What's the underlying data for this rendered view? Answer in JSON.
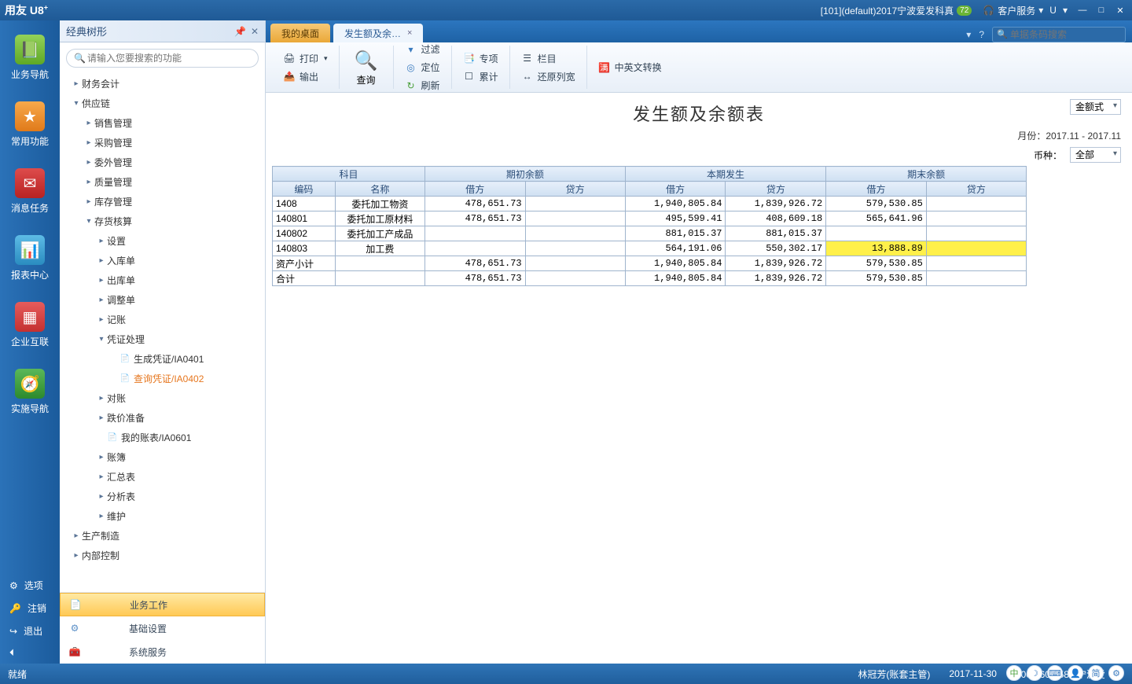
{
  "titlebar": {
    "logo": "用友 U8",
    "logo_sup": "+",
    "doc_title": "[101](default)2017宁波爱发科真",
    "badge": "72",
    "svc": "客户服务",
    "u": "U"
  },
  "leftnav": {
    "items": [
      {
        "label": "业务导航"
      },
      {
        "label": "常用功能"
      },
      {
        "label": "消息任务"
      },
      {
        "label": "报表中心"
      },
      {
        "label": "企业互联"
      },
      {
        "label": "实施导航"
      }
    ],
    "bottom": [
      {
        "icon": "⚙",
        "label": "选项"
      },
      {
        "icon": "🔑",
        "label": "注销"
      },
      {
        "icon": "↪",
        "label": "退出"
      }
    ]
  },
  "sidepanel": {
    "title": "经典树形",
    "search_placeholder": "请输入您要搜索的功能",
    "bottom_tabs": [
      {
        "label": "业务工作",
        "active": true
      },
      {
        "label": "基础设置",
        "active": false
      },
      {
        "label": "系统服务",
        "active": false
      }
    ]
  },
  "tree": [
    {
      "lvl": 1,
      "arrow": "▸",
      "label": "财务会计"
    },
    {
      "lvl": 1,
      "arrow": "▾",
      "label": "供应链"
    },
    {
      "lvl": 2,
      "arrow": "▸",
      "label": "销售管理"
    },
    {
      "lvl": 2,
      "arrow": "▸",
      "label": "采购管理"
    },
    {
      "lvl": 2,
      "arrow": "▸",
      "label": "委外管理"
    },
    {
      "lvl": 2,
      "arrow": "▸",
      "label": "质量管理"
    },
    {
      "lvl": 2,
      "arrow": "▸",
      "label": "库存管理"
    },
    {
      "lvl": 2,
      "arrow": "▾",
      "label": "存货核算"
    },
    {
      "lvl": 3,
      "arrow": "▸",
      "label": "设置"
    },
    {
      "lvl": 3,
      "arrow": "▸",
      "label": "入库单"
    },
    {
      "lvl": 3,
      "arrow": "▸",
      "label": "出库单"
    },
    {
      "lvl": 3,
      "arrow": "▸",
      "label": "调整单"
    },
    {
      "lvl": 3,
      "arrow": "▸",
      "label": "记账"
    },
    {
      "lvl": 3,
      "arrow": "▾",
      "label": "凭证处理"
    },
    {
      "lvl": 4,
      "doc": true,
      "label": "生成凭证/IA0401"
    },
    {
      "lvl": 4,
      "doc": true,
      "label": "查询凭证/IA0402",
      "sel": true
    },
    {
      "lvl": 3,
      "arrow": "▸",
      "label": "对账"
    },
    {
      "lvl": 3,
      "arrow": "▸",
      "label": "跌价准备"
    },
    {
      "lvl": 3,
      "doc": true,
      "label": "我的账表/IA0601"
    },
    {
      "lvl": 3,
      "arrow": "▸",
      "label": "账簿"
    },
    {
      "lvl": 3,
      "arrow": "▸",
      "label": "汇总表"
    },
    {
      "lvl": 3,
      "arrow": "▸",
      "label": "分析表"
    },
    {
      "lvl": 3,
      "arrow": "▸",
      "label": "维护"
    },
    {
      "lvl": 1,
      "arrow": "▸",
      "label": "生产制造"
    },
    {
      "lvl": 1,
      "arrow": "▸",
      "label": "内部控制"
    }
  ],
  "tabs": {
    "desktop": "我的桌面",
    "report": "发生额及余…"
  },
  "search_global_placeholder": "单据条码搜索",
  "ribbon": {
    "print": "打印",
    "output": "输出",
    "query": "查询",
    "filter": "过滤",
    "locate": "定位",
    "refresh": "刷新",
    "special": "专项",
    "total": "累计",
    "columns": "栏目",
    "restore": "还原列宽",
    "translate": "中英文转换"
  },
  "report": {
    "title": "发生额及余额表",
    "month_label": "月份：",
    "month": "2017.11 - 2017.11",
    "currency_label": "币种：",
    "currency": "全部",
    "mode": "金额式"
  },
  "grid": {
    "h1": {
      "subject": "科目",
      "open": "期初余额",
      "current": "本期发生",
      "close": "期末余额"
    },
    "h2": {
      "code": "编码",
      "name": "名称",
      "dr": "借方",
      "cr": "贷方"
    },
    "rows": [
      {
        "code": "1408",
        "name": "委托加工物资",
        "od": "478,651.73",
        "oc": "",
        "cd": "1,940,805.84",
        "cc": "1,839,926.72",
        "ed": "579,530.85",
        "ec": ""
      },
      {
        "code": "140801",
        "name": "委托加工原材料",
        "od": "478,651.73",
        "oc": "",
        "cd": "495,599.41",
        "cc": "408,609.18",
        "ed": "565,641.96",
        "ec": ""
      },
      {
        "code": "140802",
        "name": "委托加工产成品",
        "od": "",
        "oc": "",
        "cd": "881,015.37",
        "cc": "881,015.37",
        "ed": "",
        "ec": ""
      },
      {
        "code": "140803",
        "name": "加工费",
        "od": "",
        "oc": "",
        "cd": "564,191.06",
        "cc": "550,302.17",
        "ed": "13,888.89",
        "ec": "",
        "hl": true
      },
      {
        "code": "资产小计",
        "name": "",
        "od": "478,651.73",
        "oc": "",
        "cd": "1,940,805.84",
        "cc": "1,839,926.72",
        "ed": "579,530.85",
        "ec": ""
      },
      {
        "code": "合计",
        "name": "",
        "od": "478,651.73",
        "oc": "",
        "cd": "1,940,805.84",
        "cc": "1,839,926.72",
        "ed": "579,530.85",
        "ec": ""
      }
    ]
  },
  "status": {
    "ready": "就绪",
    "user": "林冠芳(账套主管)",
    "date": "2017-11-30",
    "hotline": "4006-600-588 宁波爱",
    "cn": "中",
    "jian": "简"
  }
}
